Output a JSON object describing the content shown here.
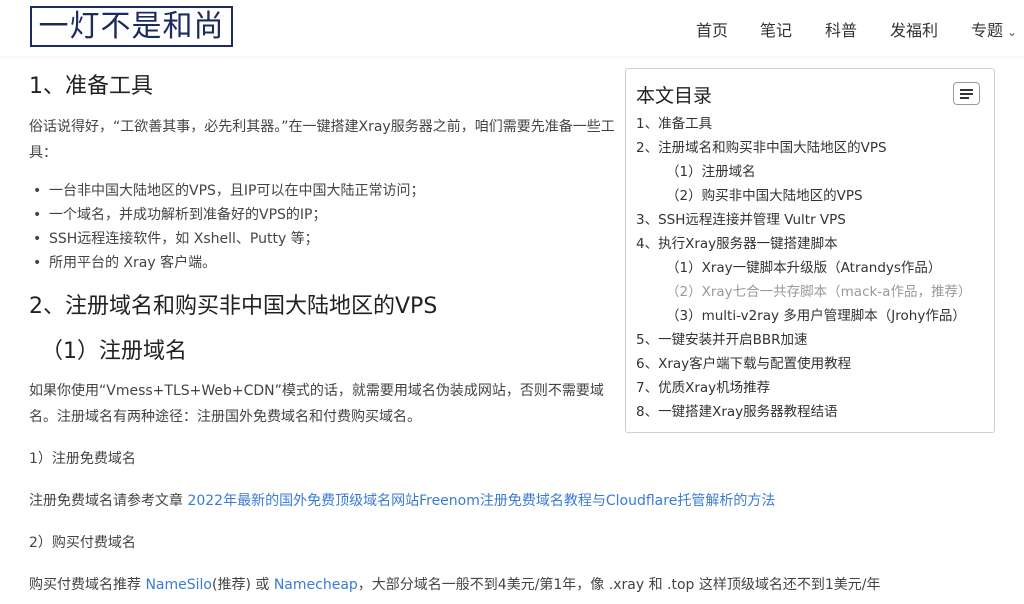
{
  "header": {
    "logo_text": "一灯不是和尚",
    "nav": [
      {
        "label": "首页"
      },
      {
        "label": "笔记"
      },
      {
        "label": "科普"
      },
      {
        "label": "发福利"
      },
      {
        "label": "专题"
      }
    ]
  },
  "article": {
    "h_prepare": "1、准备工具",
    "p_intro": "俗话说得好，“工欲善其事，必先利其器。”在一键搭建Xray服务器之前，咱们需要先准备一些工具：",
    "tools": [
      "一台非中国大陆地区的VPS，且IP可以在中国大陆正常访问；",
      "一个域名，并成功解析到准备好的VPS的IP；",
      "SSH远程连接软件，如 Xshell、Putty 等；",
      "所用平台的 Xray 客户端。"
    ],
    "h_register_vps": "2、注册域名和购买非中国大陆地区的VPS",
    "h_register_domain": "（1）注册域名",
    "p_domain": "如果你使用“Vmess+TLS+Web+CDN”模式的话，就需要用域名伪装成网站，否则不需要域名。注册域名有两种途径：注册国外免费域名和付费购买域名。",
    "p_free": "1）注册免费域名",
    "p_free_ref_prefix": "注册免费域名请参考文章 ",
    "p_free_ref_link": "2022年最新的国外免费顶级域名网站Freenom注册免费域名教程与Cloudflare托管解析的方法",
    "p_paid": "2）购买付费域名",
    "p_paid_prefix": "购买付费域名推荐 ",
    "p_paid_link1": "NameSilo",
    "p_paid_mid1": "(推荐) 或 ",
    "p_paid_link2": "Namecheap",
    "p_paid_rest": "，大部分域名一般不到4美元/第1年，像 .xray 和 .top 这样顶级域名还不到1美元/年"
  },
  "toc": {
    "title": "本文目录",
    "items": [
      {
        "label": "1、准备工具",
        "level": 1
      },
      {
        "label": "2、注册域名和购买非中国大陆地区的VPS",
        "level": 1
      },
      {
        "label": "（1）注册域名",
        "level": 2
      },
      {
        "label": "（2）购买非中国大陆地区的VPS",
        "level": 2
      },
      {
        "label": "3、SSH远程连接并管理 Vultr VPS",
        "level": 1
      },
      {
        "label": "4、执行Xray服务器一键搭建脚本",
        "level": 1
      },
      {
        "label": "（1）Xray一键脚本升级版（Atrandys作品）",
        "level": 2
      },
      {
        "label": "（2）Xray七合一共存脚本（mack-a作品，推荐）",
        "level": 2,
        "active": true
      },
      {
        "label": "（3）multi-v2ray 多用户管理脚本（Jrohy作品）",
        "level": 2
      },
      {
        "label": "5、一键安装并开启BBR加速",
        "level": 1
      },
      {
        "label": "6、Xray客户端下载与配置使用教程",
        "level": 1
      },
      {
        "label": "7、优质Xray机场推荐",
        "level": 1
      },
      {
        "label": "8、一键搭建Xray服务器教程结语",
        "level": 1
      }
    ]
  },
  "colors": {
    "logo": "#1c2b5e",
    "link": "#3a7bd5",
    "toc_active": "#999999"
  }
}
